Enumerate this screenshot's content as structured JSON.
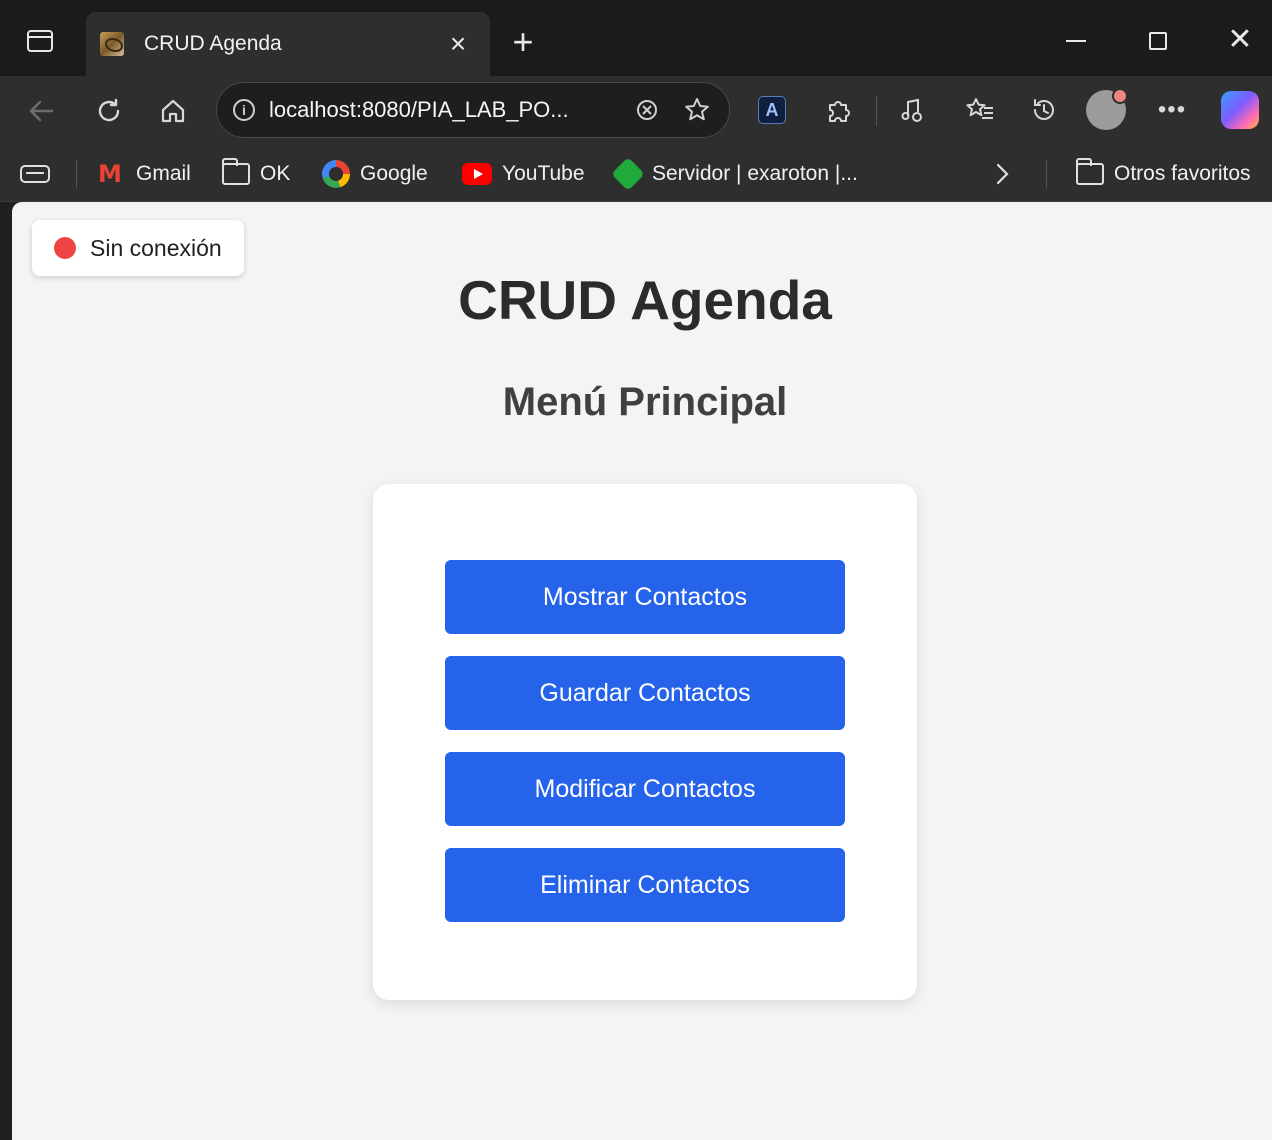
{
  "browser": {
    "tab_title": "CRUD Agenda",
    "tab_close": "×",
    "new_tab": "+",
    "url": "localhost:8080/PIA_LAB_PO...",
    "window_close": "✕"
  },
  "bookmarks": [
    {
      "label": "Gmail",
      "icon": "gmail-icon"
    },
    {
      "label": "OK",
      "icon": "folder-icon"
    },
    {
      "label": "Google",
      "icon": "google-icon"
    },
    {
      "label": "YouTube",
      "icon": "youtube-icon"
    },
    {
      "label": "Servidor | exaroton |...",
      "icon": "server-icon"
    }
  ],
  "bookmarks_other": "Otros favoritos",
  "status": {
    "text": "Sin conexión",
    "color": "#ef4444"
  },
  "page": {
    "title": "CRUD Agenda",
    "subtitle": "Menú Principal"
  },
  "menu": {
    "buttons": [
      {
        "label": "Mostrar Contactos"
      },
      {
        "label": "Guardar Contactos"
      },
      {
        "label": "Modificar Contactos"
      },
      {
        "label": "Eliminar Contactos"
      }
    ],
    "button_color": "#2563eb"
  }
}
